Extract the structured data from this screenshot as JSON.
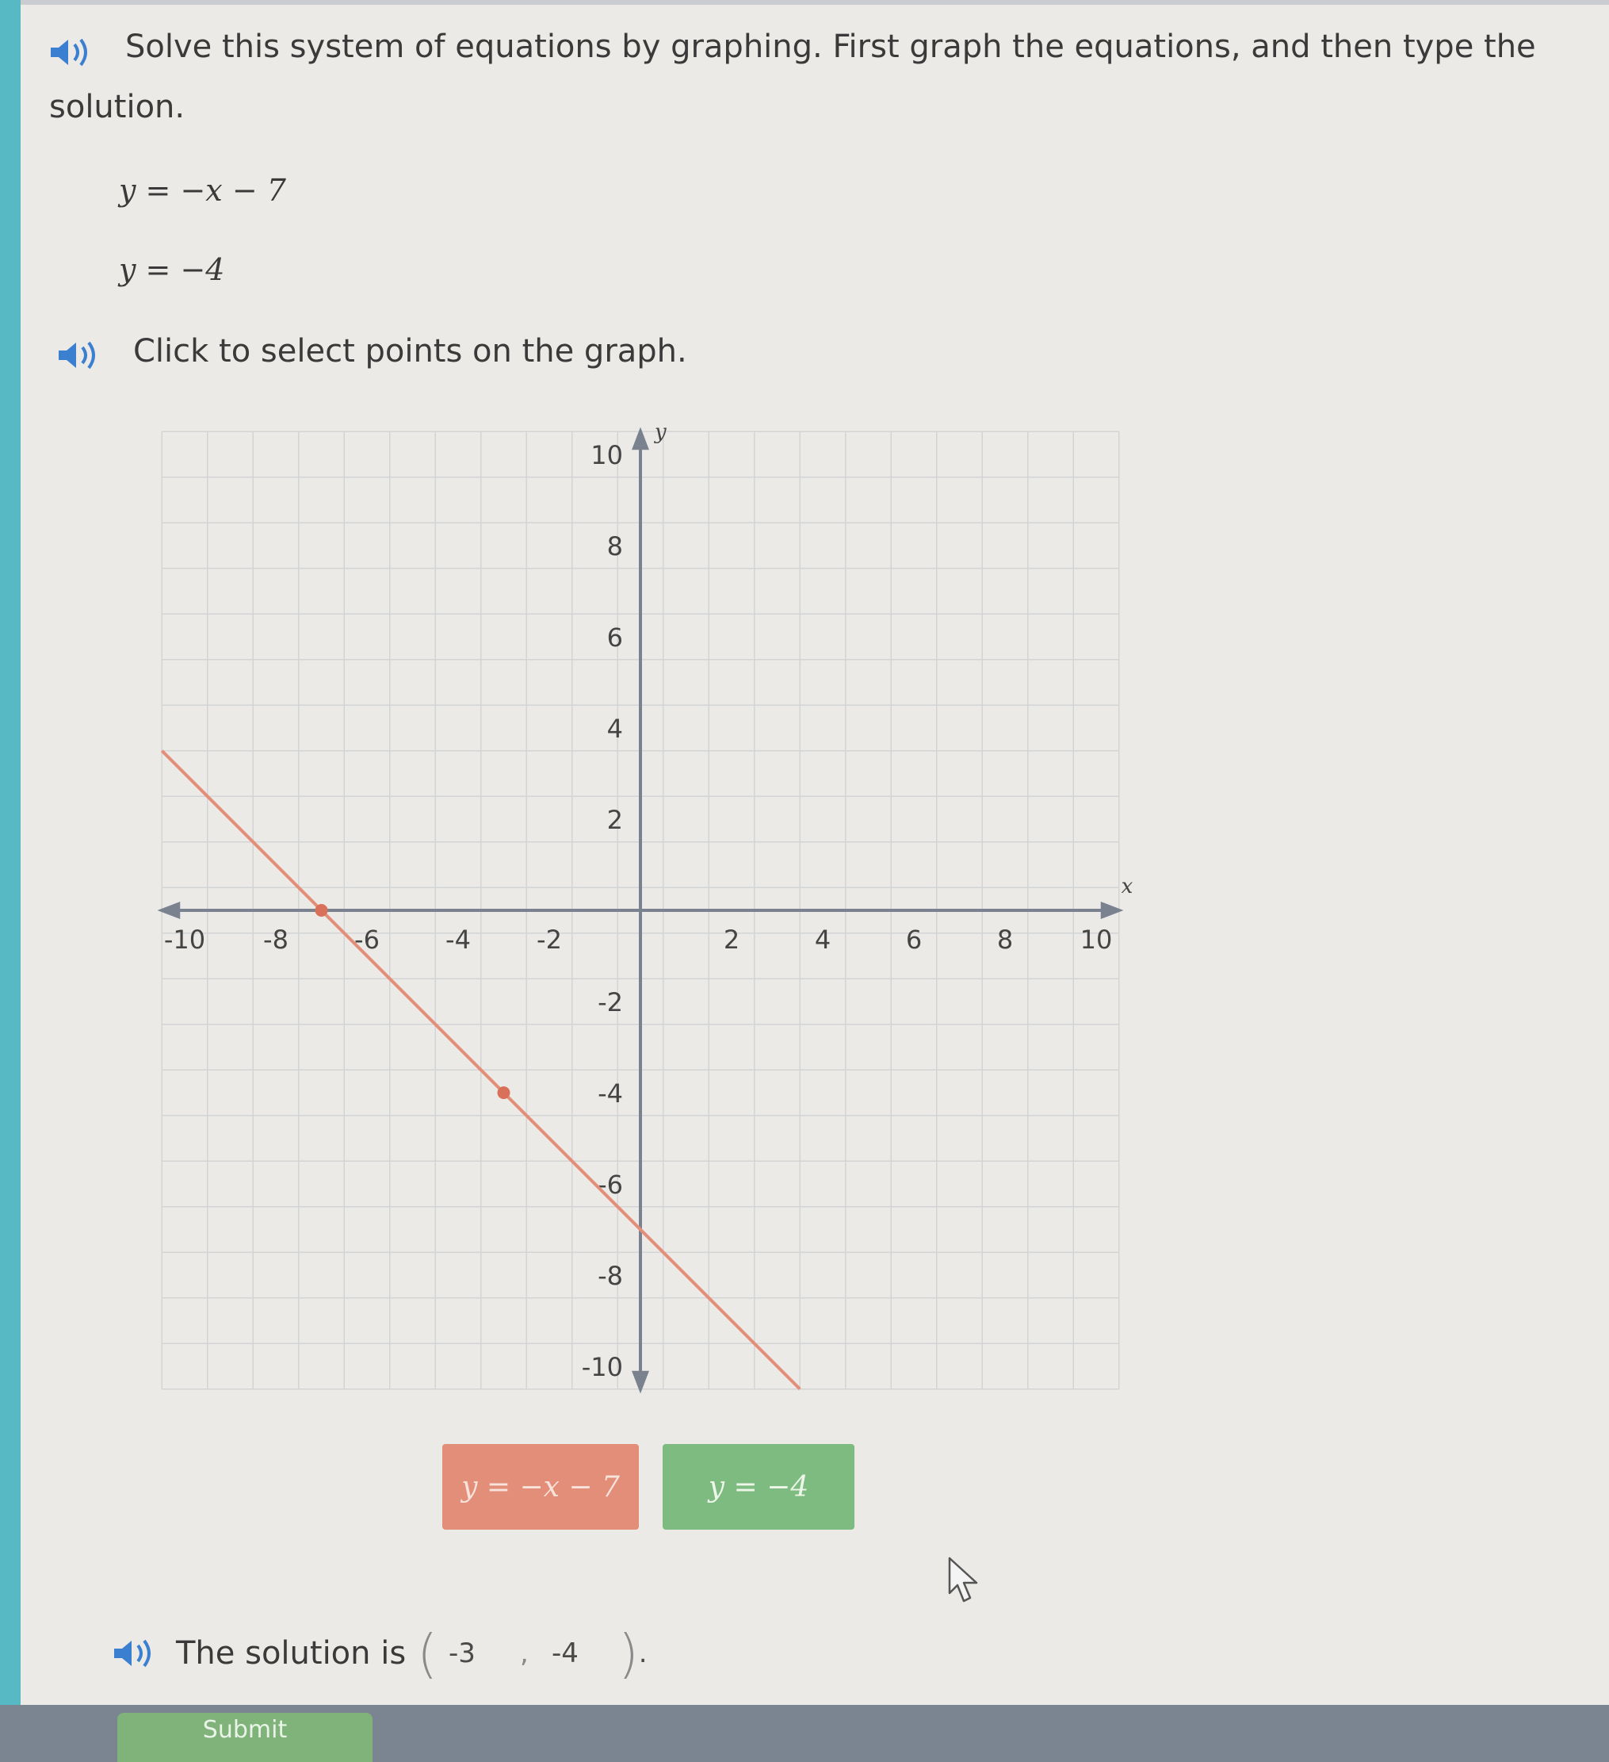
{
  "instruction_line1": "Solve this system of equations by graphing. First graph the equations, and then type the",
  "instruction_line2": "solution.",
  "equations": [
    "y = −x − 7",
    "y = −4"
  ],
  "click_prompt": "Click to select points on the graph.",
  "legend": {
    "line1_label": "y = −x − 7",
    "line2_label": "y = −4"
  },
  "solution": {
    "prefix": "The solution is",
    "x_value": "-3",
    "separator": ",",
    "y_value": "-4",
    "suffix": "."
  },
  "submit_label": "Submit",
  "colors": {
    "line1": "#e38e78",
    "line2": "#7dbb80",
    "axis": "#7a8290",
    "accent": "#56b9c3"
  },
  "icons": {
    "audio": "speaker-icon",
    "cursor": "mouse-pointer-icon"
  },
  "chart_data": {
    "type": "line",
    "x_range": [
      -10,
      10
    ],
    "y_range": [
      -10,
      10
    ],
    "x_ticks": [
      "-10",
      "-8",
      "-6",
      "-4",
      "-2",
      "2",
      "4",
      "6",
      "8",
      "10"
    ],
    "y_ticks": [
      "10",
      "8",
      "6",
      "4",
      "2",
      "-2",
      "-4",
      "-6",
      "-8",
      "-10"
    ],
    "xlabel": "x",
    "ylabel": "y",
    "grid": true,
    "series": [
      {
        "name": "y = −x − 7",
        "x": [
          -10.5,
          -7,
          -3,
          3.5
        ],
        "y": [
          3.5,
          0,
          -4,
          -10.5
        ],
        "plotted_points": [
          {
            "x": -7,
            "y": 0
          },
          {
            "x": -3,
            "y": -4
          }
        ]
      }
    ]
  }
}
